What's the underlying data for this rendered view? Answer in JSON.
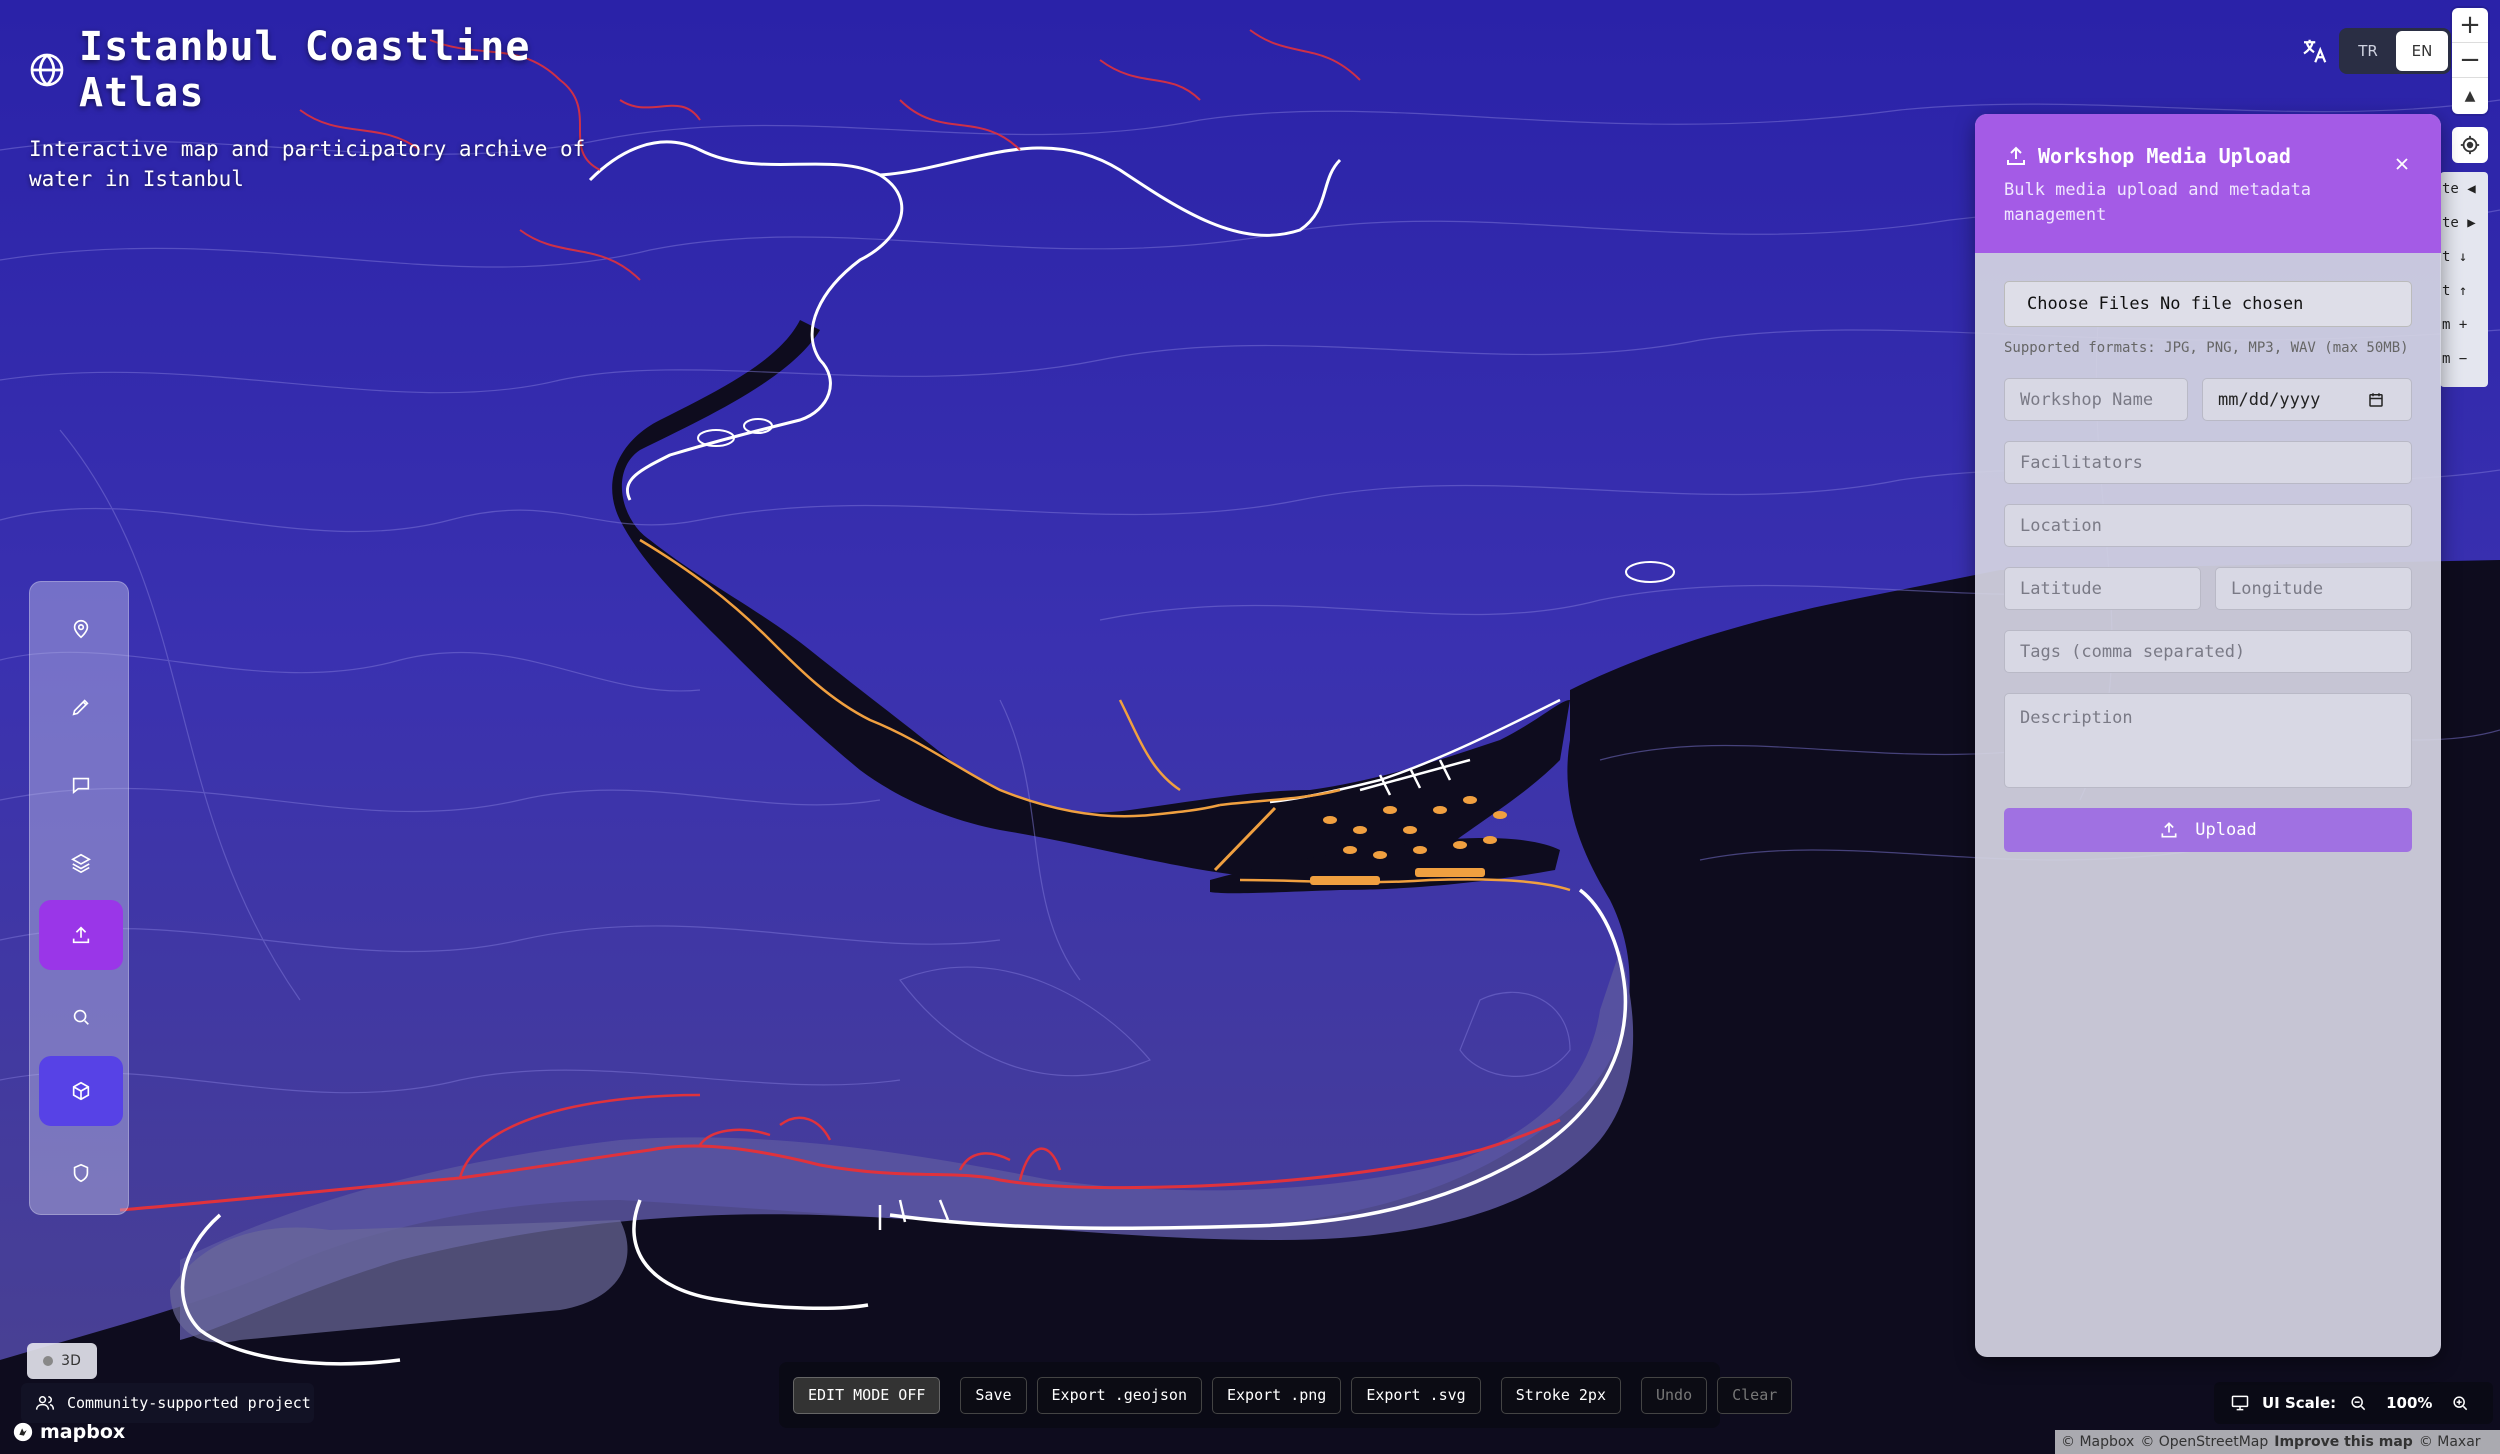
{
  "app": {
    "title": "Istanbul Coastline Atlas",
    "subtitle": "Interactive map and participatory archive of water in Istanbul"
  },
  "language": {
    "options": [
      "TR",
      "EN"
    ],
    "active": "EN"
  },
  "map_controls": {
    "zoom_in": "+",
    "zoom_out": "−",
    "compass": "▲"
  },
  "hidden_strip": {
    "items": [
      "te ◀",
      "te ▶",
      "t ↓",
      "t ↑",
      "m +",
      "m −"
    ]
  },
  "toolbar": {
    "tools": [
      {
        "name": "pin",
        "icon": "map-pin-icon"
      },
      {
        "name": "draw",
        "icon": "pencil-icon"
      },
      {
        "name": "comment",
        "icon": "message-icon"
      },
      {
        "name": "layers",
        "icon": "layers-icon"
      },
      {
        "name": "upload",
        "icon": "upload-icon",
        "active": true
      },
      {
        "name": "search",
        "icon": "search-icon"
      },
      {
        "name": "3d",
        "icon": "cube-icon",
        "active": true
      },
      {
        "name": "shield",
        "icon": "shield-icon"
      }
    ]
  },
  "badge_3d": "3D",
  "community": "Community-supported project",
  "mapbox": "mapbox",
  "editbar": {
    "edit_mode": "EDIT MODE OFF",
    "save": "Save",
    "export_geojson": "Export .geojson",
    "export_png": "Export .png",
    "export_svg": "Export .svg",
    "stroke": "Stroke 2px",
    "undo": "Undo",
    "clear": "Clear"
  },
  "uiscale": {
    "label": "UI Scale:",
    "value": "100%"
  },
  "attribution": {
    "mapbox": "© Mapbox",
    "osm": "© OpenStreetMap",
    "improve": "Improve this map",
    "maxar": "© Maxar"
  },
  "panel": {
    "title": "Workshop Media Upload",
    "subtitle": "Bulk media upload and metadata management",
    "file_picker": "Choose Files No file chosen",
    "formats": "Supported formats: JPG, PNG, MP3, WAV (max 50MB)",
    "workshop_name_placeholder": "Workshop Name",
    "date_placeholder": "mm/dd/yyyy",
    "facilitators_placeholder": "Facilitators",
    "location_placeholder": "Location",
    "latitude_placeholder": "Latitude",
    "longitude_placeholder": "Longitude",
    "tags_placeholder": "Tags (comma separated)",
    "description_placeholder": "Description",
    "upload_button": "Upload"
  },
  "colors": {
    "accent_purple": "#a45be6",
    "accent_indigo": "#5742e6",
    "map_land": "#3b2fa6",
    "water": "#0e0c1e",
    "coast_red": "#e0323c",
    "coast_orange": "#f0a040"
  }
}
